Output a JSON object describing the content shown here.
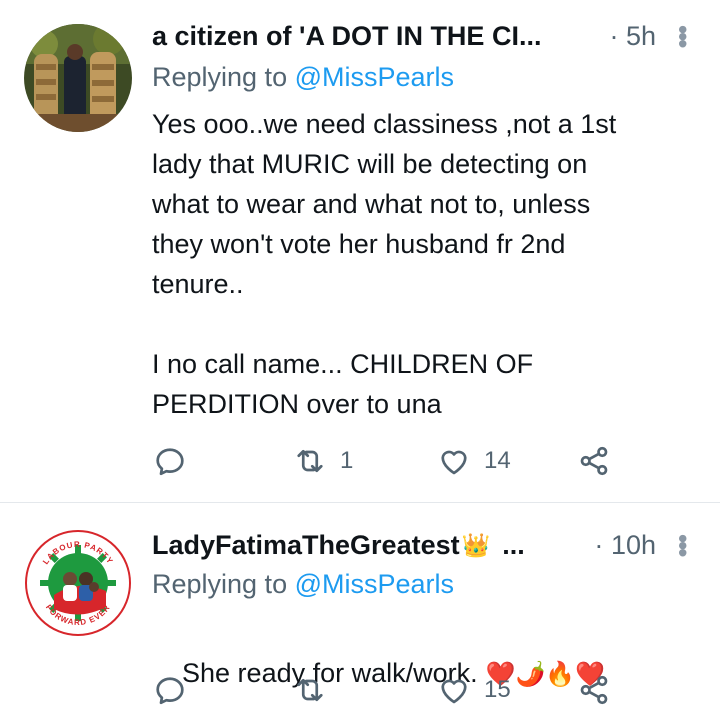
{
  "tweets": [
    {
      "name": "a citizen of 'A DOT IN THE CI...",
      "time_sep": "·",
      "time": "5h",
      "reply_prefix": "Replying to",
      "reply_handle": "@MissPearls",
      "text": "Yes ooo..we need classiness ,not a 1st\nlady that MURIC will be detecting on\nwhat to wear and what not to, unless\nthey won't vote her husband fr 2nd\ntenure..\n\nI no call name... CHILDREN OF\nPERDITION over to una",
      "reply_count": "",
      "retweet_count": "1",
      "like_count": "14"
    },
    {
      "name": "LadyFatimaTheGreatest",
      "name_emoji": "👑",
      "name_more": "...",
      "time_sep": "·",
      "time": "10h",
      "reply_prefix": "Replying to",
      "reply_handle": "@MissPearls",
      "text": "She ready for walk/work.",
      "text_emojis": "❤️🌶️🔥❤️",
      "reply_count": "",
      "retweet_count": "",
      "like_count": "15"
    }
  ],
  "avatar2": {
    "top_text": "LABOUR PARTY",
    "bottom_text": "FORWARD EVER"
  },
  "colors": {
    "accent": "#1d9bf0",
    "secondary_text": "#536471",
    "divider": "#e4e8ec",
    "lp_red": "#d7262b",
    "lp_green": "#1e9a3f"
  }
}
